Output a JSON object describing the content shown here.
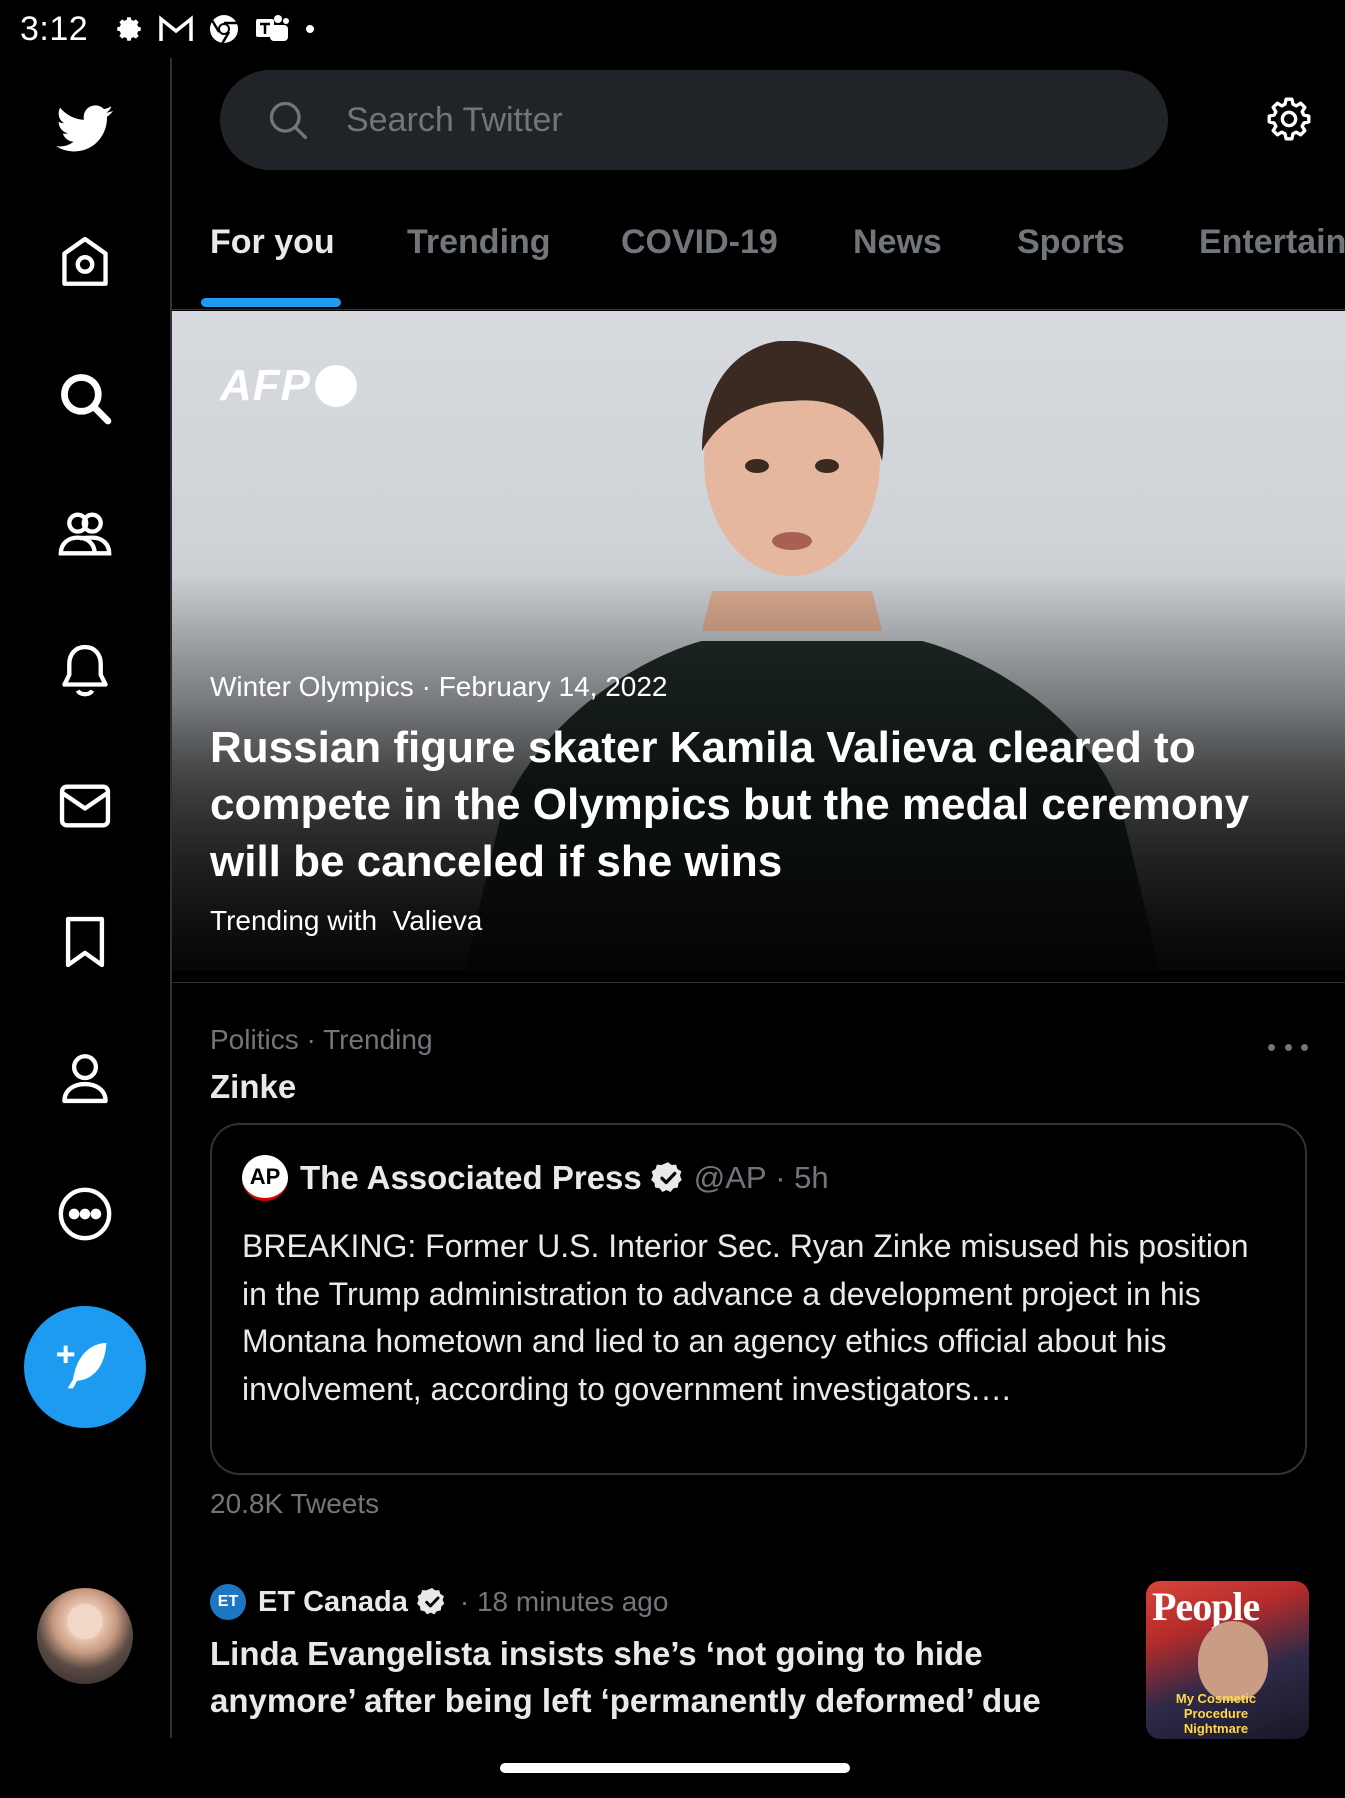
{
  "status_bar": {
    "time": "3:12",
    "icons": [
      "settings-icon",
      "gmail-icon",
      "chrome-icon",
      "teams-icon",
      "dot-icon"
    ]
  },
  "sidebar": {
    "items": [
      {
        "name": "twitter-logo-icon"
      },
      {
        "name": "home-icon"
      },
      {
        "name": "explore-search-icon"
      },
      {
        "name": "communities-icon"
      },
      {
        "name": "notifications-bell-icon"
      },
      {
        "name": "messages-envelope-icon"
      },
      {
        "name": "bookmarks-icon"
      },
      {
        "name": "profile-icon"
      },
      {
        "name": "more-icon"
      }
    ],
    "accent": "#1d9bf0"
  },
  "search": {
    "placeholder": "Search Twitter"
  },
  "tabs": [
    {
      "label": "For you",
      "active": true
    },
    {
      "label": "Trending",
      "active": false
    },
    {
      "label": "COVID-19",
      "active": false
    },
    {
      "label": "News",
      "active": false
    },
    {
      "label": "Sports",
      "active": false
    },
    {
      "label": "Entertain",
      "active": false
    }
  ],
  "hero": {
    "source_logo": "AFP",
    "category": "Winter Olympics",
    "date": "February 14, 2022",
    "headline": "Russian figure skater Kamila Valieva cleared to compete in the Olympics but the medal ceremony will be canceled if she wins",
    "trending_prefix": "Trending with",
    "trending_term": "Valieva"
  },
  "trend": {
    "meta": "Politics · Trending",
    "title": "Zinke",
    "quote": {
      "logo": "AP",
      "author": "The Associated Press",
      "handle": "@AP",
      "time": "5h",
      "text": "BREAKING: Former U.S. Interior Sec. Ryan Zinke misused his position in the Trump administration to advance a development project in his Montana hometown and lied to an agency ethics official about his involvement, according to government investigators.…"
    },
    "tweet_count": "20.8K Tweets"
  },
  "news": {
    "source_logo": "ET",
    "source": "ET Canada",
    "time": "18 minutes ago",
    "title": "Linda Evangelista insists she’s ‘not going to hide anymore’ after being left ‘permanently deformed’ due",
    "thumbnail": {
      "magazine": "People",
      "cover_line": "My Cosmetic Procedure Nightmare"
    }
  },
  "colors": {
    "background": "#000000",
    "accent": "#1d9bf0",
    "muted_text": "#71767b",
    "divider": "#2f3336"
  }
}
